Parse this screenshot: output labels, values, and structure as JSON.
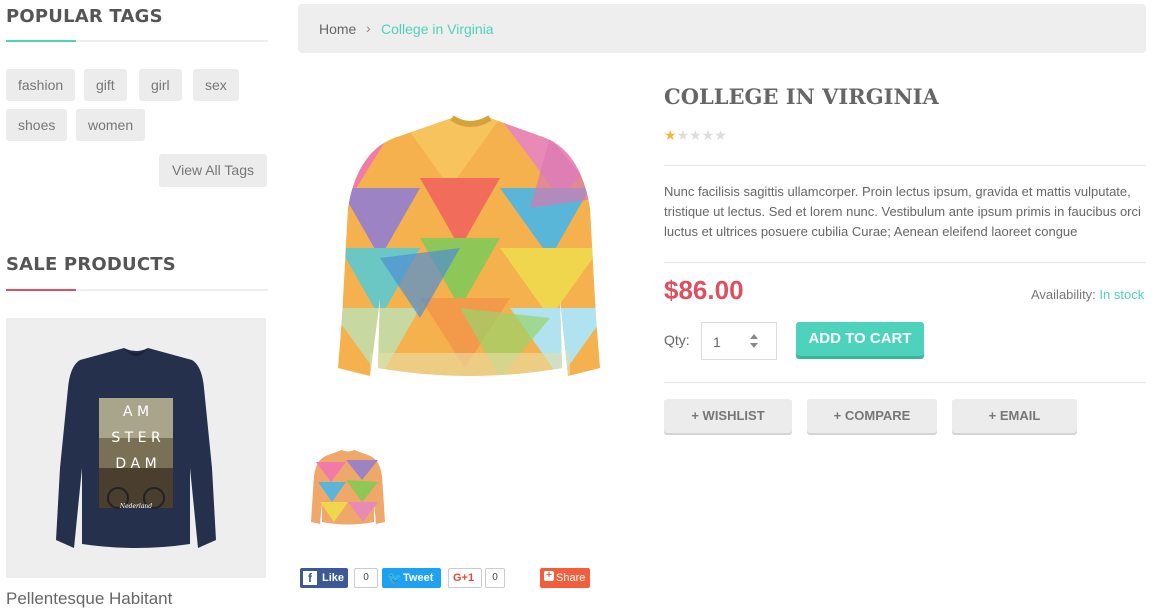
{
  "sidebar": {
    "popular_tags_title": "POPULAR TAGS",
    "tags": [
      "fashion",
      "gift",
      "girl",
      "sex",
      "shoes",
      "women"
    ],
    "view_all_label": "View All Tags",
    "sale_products_title": "SALE PRODUCTS",
    "sale_product_name": "Pellentesque Habitant",
    "sale_product_print": [
      "A M",
      "S T E R",
      "D A M",
      "Nederland"
    ]
  },
  "breadcrumb": {
    "home": "Home",
    "separator": "›",
    "current": "College in Virginia"
  },
  "product": {
    "title": "COLLEGE IN VIRGINIA",
    "rating": 1,
    "rating_max": 5,
    "description": "Nunc facilisis sagittis ullamcorper. Proin lectus ipsum, gravida et mattis vulputate, tristique ut lectus. Sed et lorem nunc. Vestibulum ante ipsum primis in faucibus orci luctus et ultrices posuere cubilia Curae; Aenean eleifend laoreet congue",
    "price": "$86.00",
    "availability_label": "Availability:",
    "availability_value": "In stock",
    "qty_label": "Qty:",
    "qty_value": "1",
    "add_to_cart_label": "ADD TO CART",
    "wishlist_label": "+ WISHLIST",
    "compare_label": "+ COMPARE",
    "email_label": "+ EMAIL"
  },
  "social": {
    "like_label": "Like",
    "like_count": "0",
    "tweet_label": "Tweet",
    "gplus_label": "G+1",
    "gplus_count": "0",
    "share_label": "Share"
  },
  "colors": {
    "accent_teal": "#4dd3bb",
    "accent_red": "#e04f5f",
    "price_red": "#e04f5f",
    "facebook": "#3b5998",
    "twitter": "#1da1f2",
    "share_orange": "#f25e3c"
  },
  "icons": {
    "facebook": "facebook-icon",
    "twitter": "twitter-icon",
    "google_plus": "google-plus-icon",
    "share": "share-icon",
    "spinner": "qty-spinner-icon",
    "star": "star-icon"
  }
}
